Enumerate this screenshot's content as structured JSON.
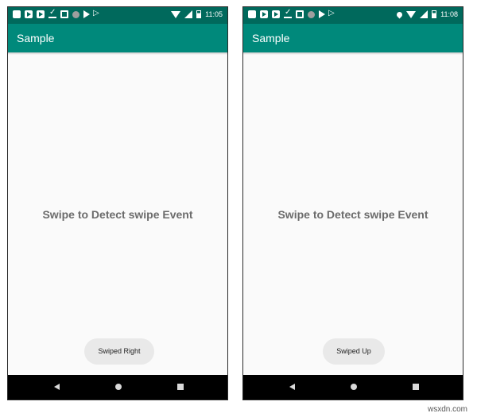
{
  "screens": [
    {
      "status_time": "11:05",
      "app_title": "Sample",
      "center_text": "Swipe to Detect swipe Event",
      "toast": "Swiped Right"
    },
    {
      "status_time": "11:08",
      "app_title": "Sample",
      "center_text": "Swipe to Detect swipe Event",
      "toast": "Swiped Up"
    }
  ],
  "colors": {
    "status_bar": "#00695c",
    "app_bar": "#00897b",
    "background": "#fafafa",
    "nav_bar": "#000000"
  },
  "watermark": "wsxdn.com"
}
